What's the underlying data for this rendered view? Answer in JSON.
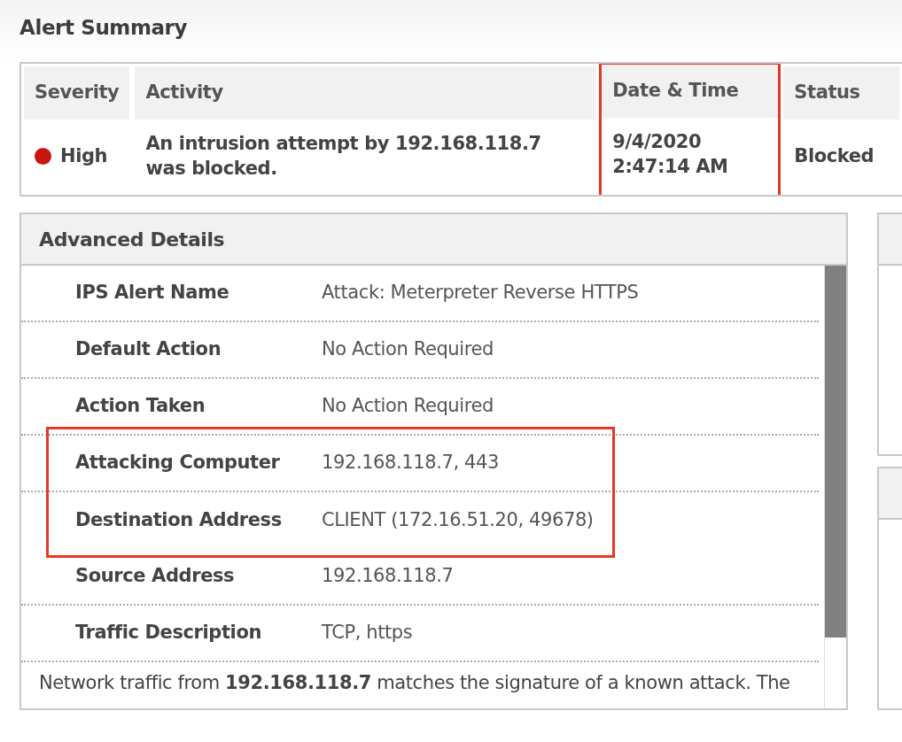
{
  "title": "Alert Summary",
  "summary": {
    "columns": [
      {
        "label": "Severity",
        "highlighted": false
      },
      {
        "label": "Activity",
        "highlighted": false
      },
      {
        "label": "Date & Time",
        "highlighted": true
      },
      {
        "label": "Status",
        "highlighted": false
      }
    ],
    "row": {
      "severity": {
        "label": "High",
        "color": "#c8160e"
      },
      "activity": "An intrusion attempt by 192.168.118.7 was blocked.",
      "date_time": [
        "9/4/2020",
        "2:47:14 AM"
      ],
      "status": "Blocked"
    }
  },
  "details": {
    "title": "Advanced Details",
    "rows": [
      {
        "label": "IPS Alert Name",
        "value": "Attack: Meterpreter Reverse HTTPS",
        "highlighted": false
      },
      {
        "label": "Default Action",
        "value": "No Action Required",
        "highlighted": false
      },
      {
        "label": "Action Taken",
        "value": "No Action Required",
        "highlighted": false
      },
      {
        "label": "Attacking Computer",
        "value": "192.168.118.7, 443",
        "highlighted": true
      },
      {
        "label": "Destination Address",
        "value": "CLIENT (172.16.51.20, 49678)",
        "highlighted": true
      },
      {
        "label": "Source Address",
        "value": "192.168.118.7",
        "highlighted": false
      },
      {
        "label": "Traffic Description",
        "value": "TCP, https",
        "highlighted": false
      }
    ],
    "description": "Network traffic from **192.168.118.7** matches the signature of a known attack. The"
  }
}
